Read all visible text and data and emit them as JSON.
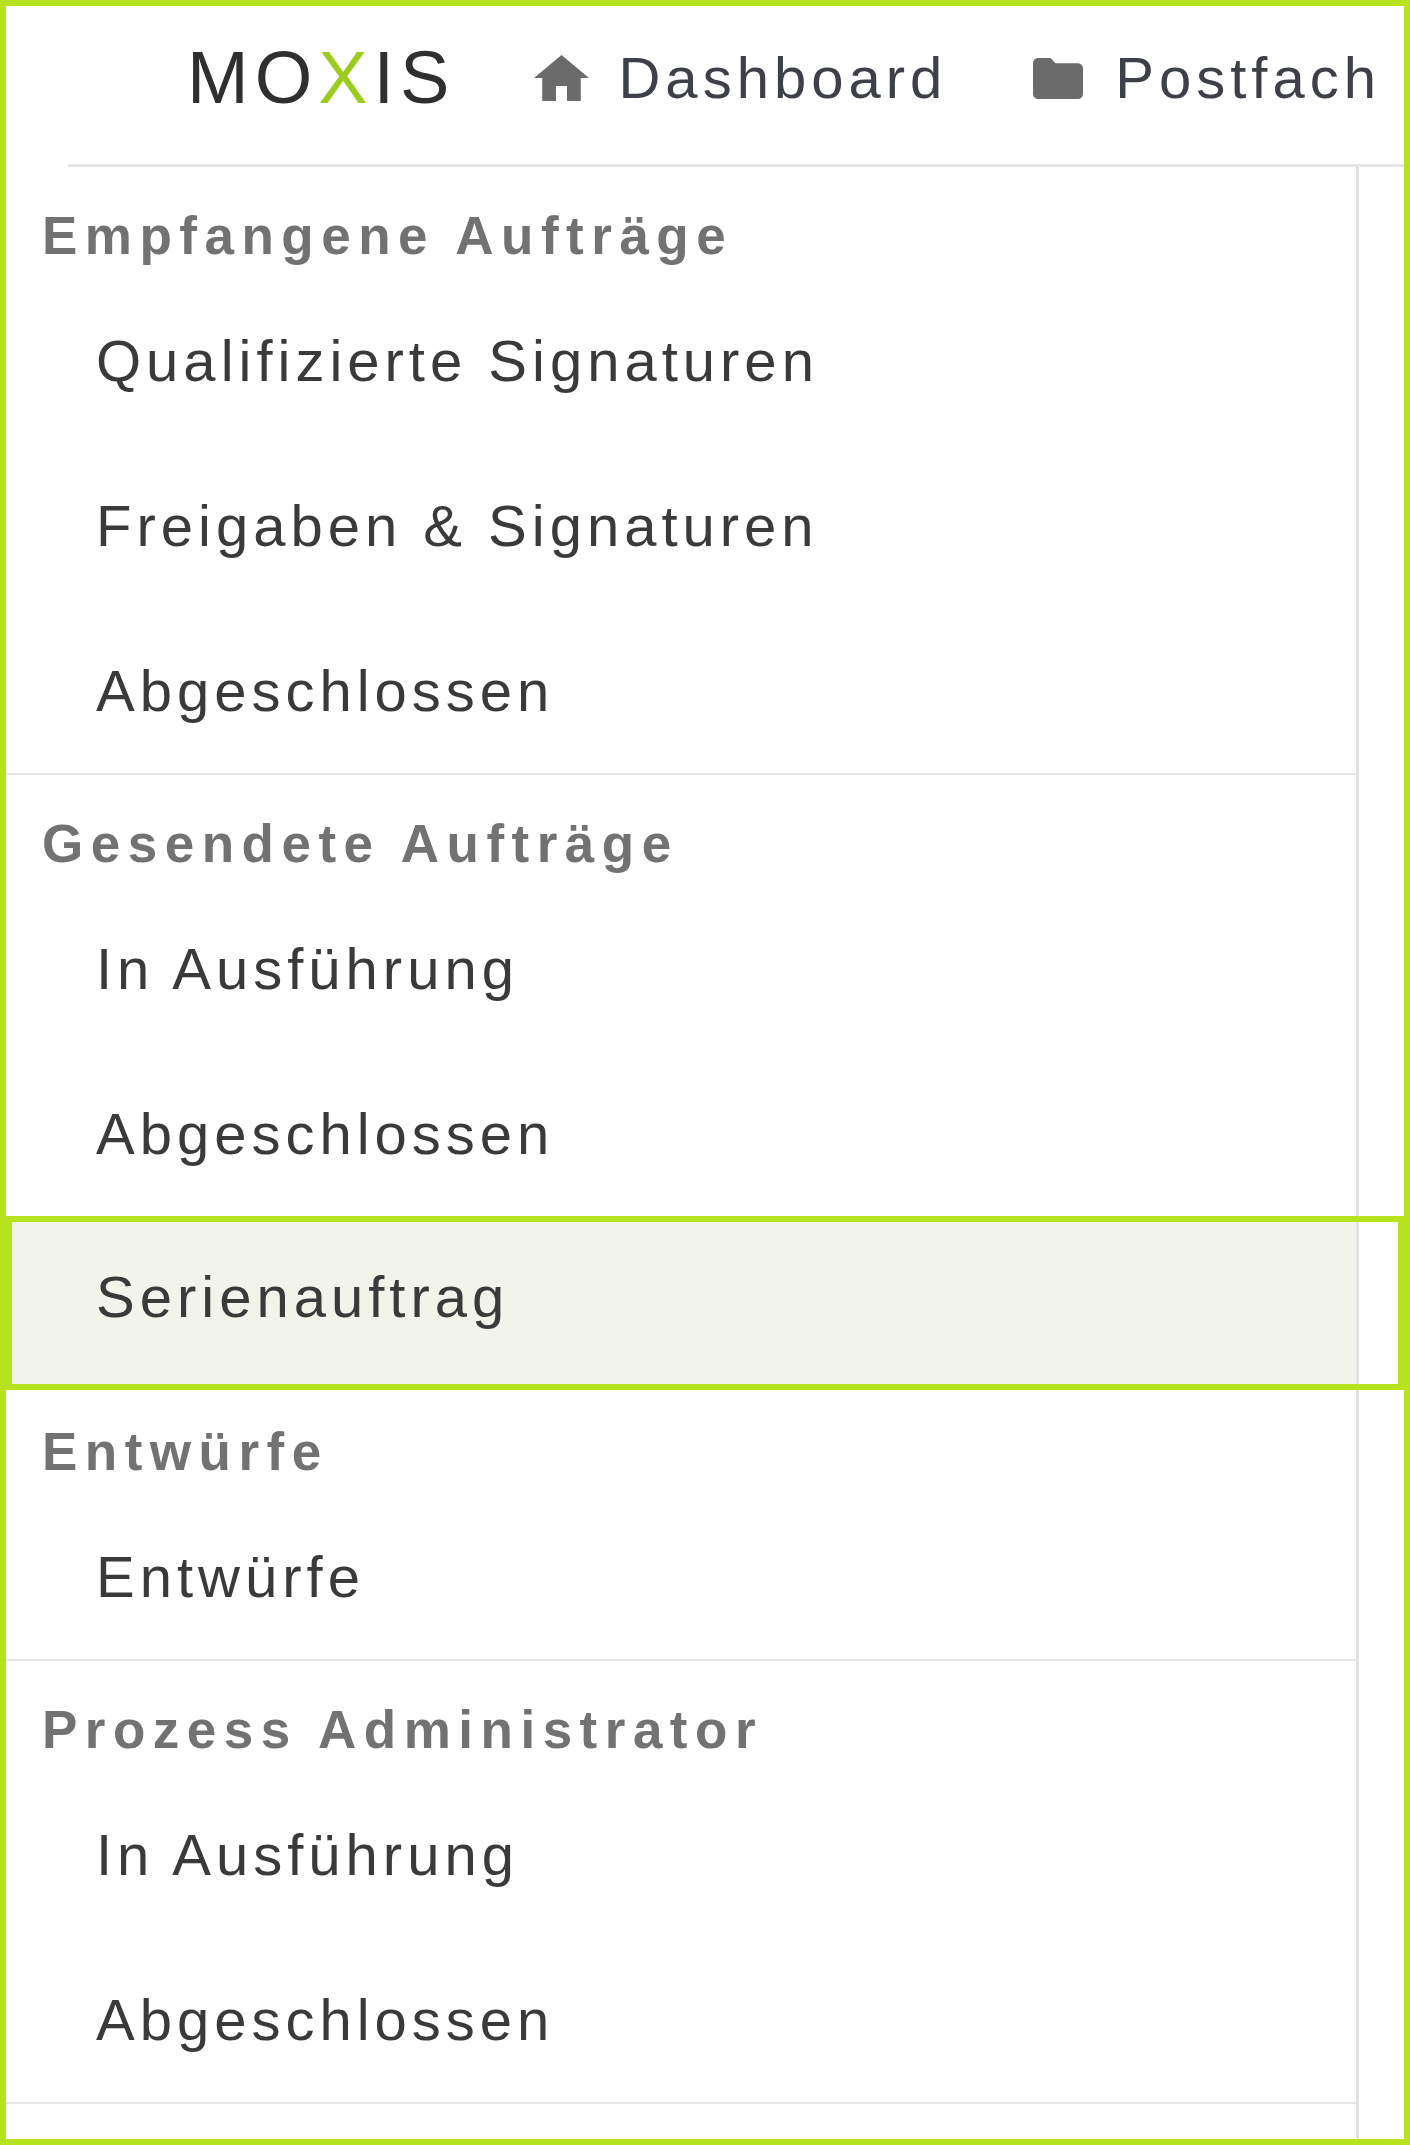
{
  "logo": {
    "before": "MO",
    "accent": "X",
    "after": "IS"
  },
  "nav": [
    {
      "label": "Dashboard"
    },
    {
      "label": "Postfach"
    }
  ],
  "sections": [
    {
      "title": "Empfangene Aufträge",
      "items": [
        {
          "label": "Qualifizierte Signaturen",
          "selected": false
        },
        {
          "label": "Freigaben & Signaturen",
          "selected": false
        },
        {
          "label": "Abgeschlossen",
          "selected": false
        }
      ]
    },
    {
      "title": "Gesendete Aufträge",
      "items": [
        {
          "label": "In Ausführung",
          "selected": false
        },
        {
          "label": "Abgeschlossen",
          "selected": false
        },
        {
          "label": "Serienauftrag",
          "selected": true
        }
      ]
    },
    {
      "title": "Entwürfe",
      "items": [
        {
          "label": "Entwürfe",
          "selected": false
        }
      ]
    },
    {
      "title": "Prozess Administrator",
      "items": [
        {
          "label": "In Ausführung",
          "selected": false
        },
        {
          "label": "Abgeschlossen",
          "selected": false
        }
      ]
    }
  ]
}
